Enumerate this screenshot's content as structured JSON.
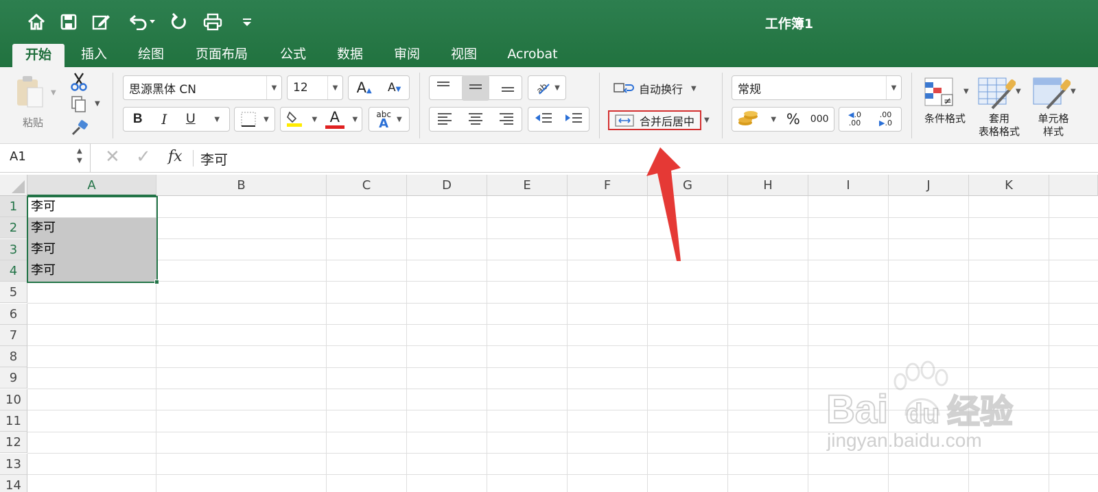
{
  "window": {
    "title": "工作簿1"
  },
  "quick_access": [
    "home-icon",
    "save-icon",
    "edit-icon",
    "undo-icon",
    "redo-icon",
    "print-icon",
    "customize-icon"
  ],
  "tabs": [
    {
      "label": "开始",
      "active": true
    },
    {
      "label": "插入"
    },
    {
      "label": "绘图"
    },
    {
      "label": "页面布局"
    },
    {
      "label": "公式"
    },
    {
      "label": "数据"
    },
    {
      "label": "审阅"
    },
    {
      "label": "视图"
    },
    {
      "label": "Acrobat"
    }
  ],
  "ribbon": {
    "paste_label": "粘贴",
    "font_name": "思源黑体 CN",
    "font_size": "12",
    "bold": "B",
    "italic": "I",
    "underline": "U",
    "grow_font": "A",
    "shrink_font": "A",
    "font_color_glyph": "A",
    "abc_label": "abc",
    "abc_glyph": "A",
    "wrap_text": "自动换行",
    "merge_center": "合并后居中",
    "number_format": "常规",
    "percent": "%",
    "comma": "000",
    "dec_inc_top": ".0",
    "dec_inc_bottom": ".00",
    "dec_dec_top": ".00",
    "dec_dec_bottom": ".0",
    "cond_format": "条件格式",
    "table_format_1": "套用",
    "table_format_2": "表格格式",
    "cell_style_1": "单元格",
    "cell_style_2": "样式"
  },
  "formula_bar": {
    "name_box": "A1",
    "fx": "fx",
    "content": "李可"
  },
  "sheet": {
    "columns": [
      "A",
      "B",
      "C",
      "D",
      "E",
      "F",
      "G",
      "H",
      "I",
      "J",
      "K"
    ],
    "rows": [
      "1",
      "2",
      "3",
      "4",
      "5",
      "6",
      "7",
      "8",
      "9",
      "10",
      "11",
      "12",
      "13",
      "14"
    ],
    "cells": [
      {
        "ref": "A1",
        "value": "李可"
      },
      {
        "ref": "A2",
        "value": "李可"
      },
      {
        "ref": "A3",
        "value": "李可"
      },
      {
        "ref": "A4",
        "value": "李可"
      }
    ],
    "selection": "A1:A4"
  },
  "watermark": {
    "brand": "Baidu经验",
    "url": "jingyan.baidu.com"
  },
  "colors": {
    "title_bar": "#21723f",
    "accent_green": "#1f6e3c",
    "highlight_red": "#d32f2f",
    "arrow_red": "#e53935",
    "selection_fill": "#c8c8c8"
  }
}
